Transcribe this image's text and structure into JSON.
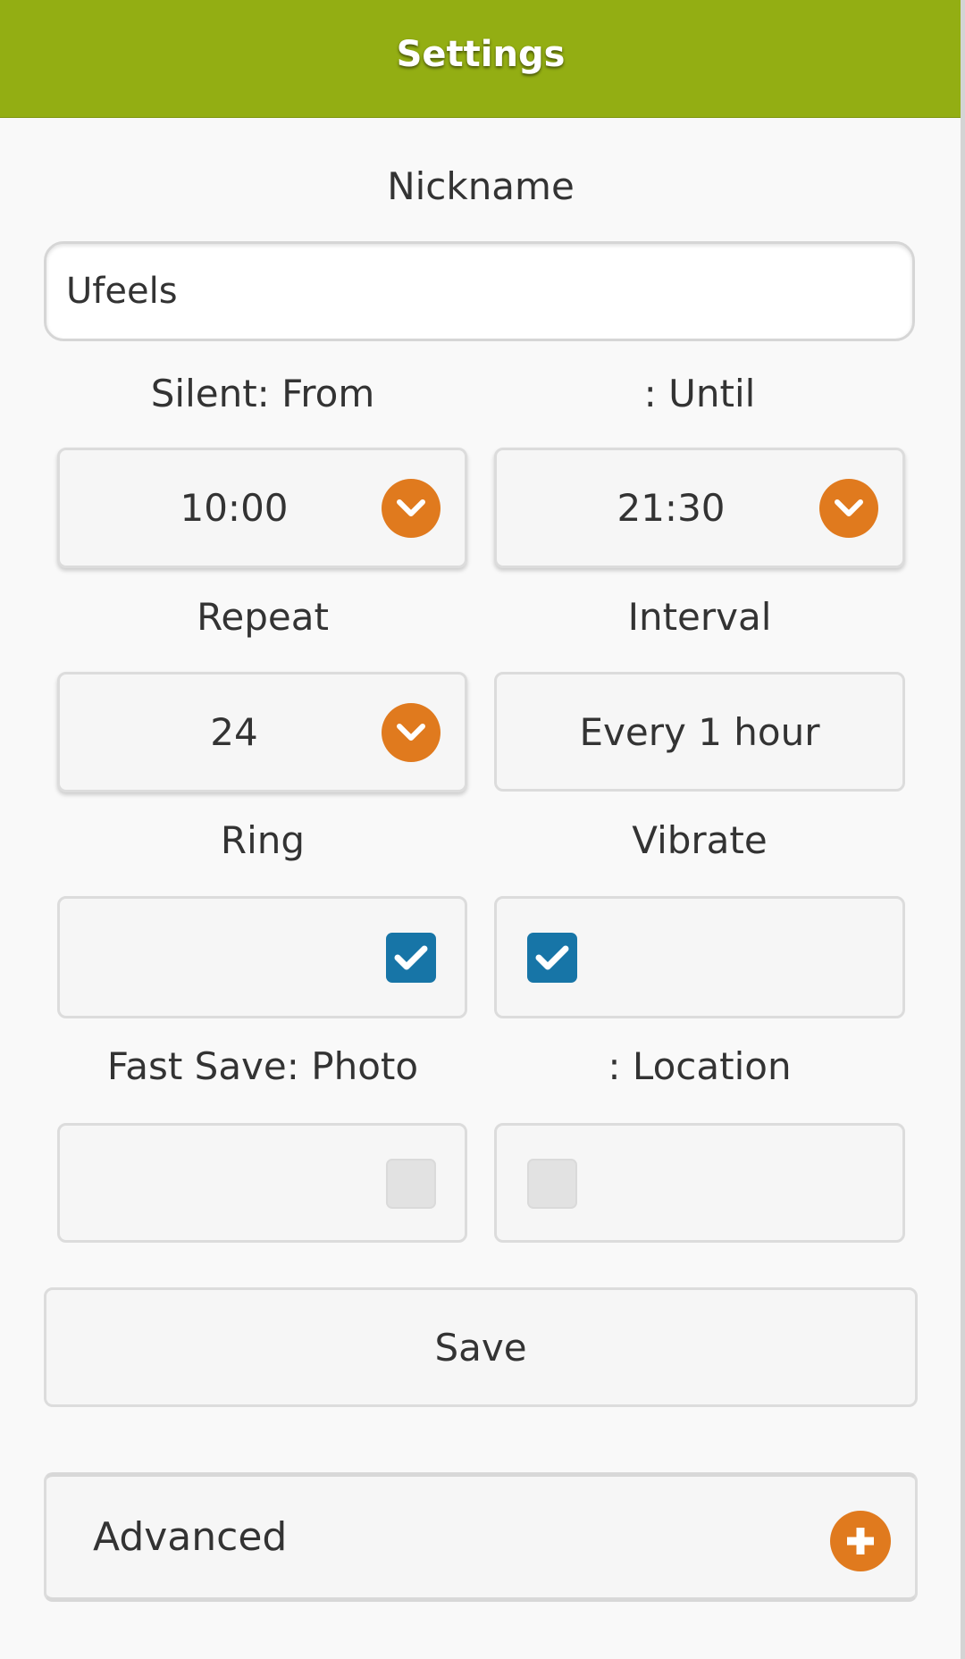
{
  "header": {
    "title": "Settings"
  },
  "nickname": {
    "label": "Nickname",
    "value": "Ufeels"
  },
  "silent": {
    "from_label": "Silent: From",
    "until_label": ": Until",
    "from_value": "10:00",
    "until_value": "21:30"
  },
  "repeat": {
    "label": "Repeat",
    "value": "24"
  },
  "interval": {
    "label": "Interval",
    "value": "Every 1 hour"
  },
  "ring": {
    "label": "Ring",
    "checked": true
  },
  "vibrate": {
    "label": "Vibrate",
    "checked": true
  },
  "fast_save": {
    "photo_label": "Fast Save: Photo",
    "location_label": ": Location",
    "photo_checked": false,
    "location_checked": false
  },
  "save_button": {
    "label": "Save"
  },
  "advanced": {
    "label": "Advanced"
  },
  "colors": {
    "header": "#93ae13",
    "accent": "#e07a1e",
    "checkbox": "#1775a7"
  },
  "icons": [
    "chevron-down-icon",
    "checkmark-icon",
    "plus-icon"
  ]
}
